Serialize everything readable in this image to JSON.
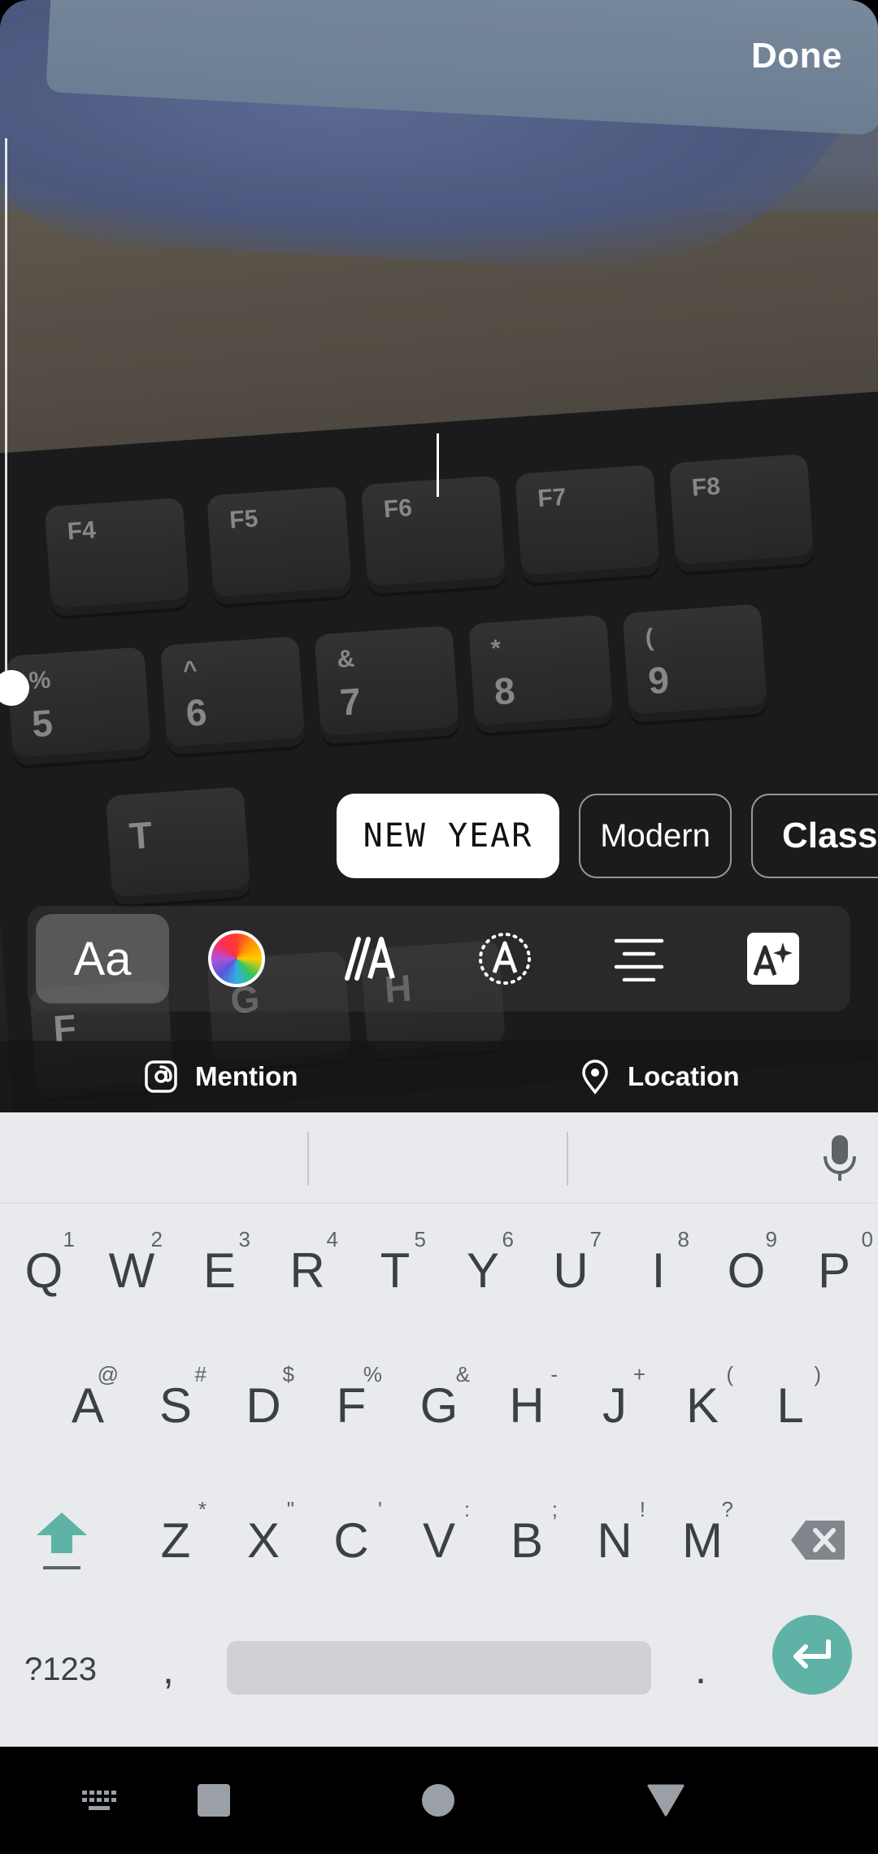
{
  "editor": {
    "done_label": "Done",
    "font_styles": [
      "NEW YEAR",
      "Modern",
      "Classic"
    ],
    "selected_font": "NEW YEAR",
    "tools": [
      "text-style",
      "color",
      "text-effect",
      "text-animation",
      "alignment",
      "ai-text"
    ],
    "tool_text_label": "Aa",
    "mention_label": "Mention",
    "location_label": "Location"
  },
  "background_photo": {
    "key_labels": [
      "F4",
      "F5",
      "F6",
      "F7",
      "F8",
      "%",
      "5",
      "^",
      "6",
      "&",
      "7",
      "*",
      "8",
      "(",
      "9",
      "T",
      "G",
      "H",
      "F"
    ]
  },
  "keyboard": {
    "row1": [
      {
        "key": "Q",
        "sup": "1"
      },
      {
        "key": "W",
        "sup": "2"
      },
      {
        "key": "E",
        "sup": "3"
      },
      {
        "key": "R",
        "sup": "4"
      },
      {
        "key": "T",
        "sup": "5"
      },
      {
        "key": "Y",
        "sup": "6"
      },
      {
        "key": "U",
        "sup": "7"
      },
      {
        "key": "I",
        "sup": "8"
      },
      {
        "key": "O",
        "sup": "9"
      },
      {
        "key": "P",
        "sup": "0"
      }
    ],
    "row2": [
      {
        "key": "A",
        "sup": "@"
      },
      {
        "key": "S",
        "sup": "#"
      },
      {
        "key": "D",
        "sup": "$"
      },
      {
        "key": "F",
        "sup": "%"
      },
      {
        "key": "G",
        "sup": "&"
      },
      {
        "key": "H",
        "sup": "-"
      },
      {
        "key": "J",
        "sup": "+"
      },
      {
        "key": "K",
        "sup": "("
      },
      {
        "key": "L",
        "sup": ")"
      }
    ],
    "row3": [
      {
        "key": "Z",
        "sup": "*"
      },
      {
        "key": "X",
        "sup": "\""
      },
      {
        "key": "C",
        "sup": "'"
      },
      {
        "key": "V",
        "sup": ":"
      },
      {
        "key": "B",
        "sup": ";"
      },
      {
        "key": "N",
        "sup": "!"
      },
      {
        "key": "M",
        "sup": "?"
      }
    ],
    "symbols_label": "?123",
    "comma_label": ",",
    "period_label": ".",
    "accent_color": "#5fb3a6"
  },
  "navbar": {
    "buttons": [
      "keyboard-switch",
      "recents",
      "home",
      "back"
    ]
  }
}
